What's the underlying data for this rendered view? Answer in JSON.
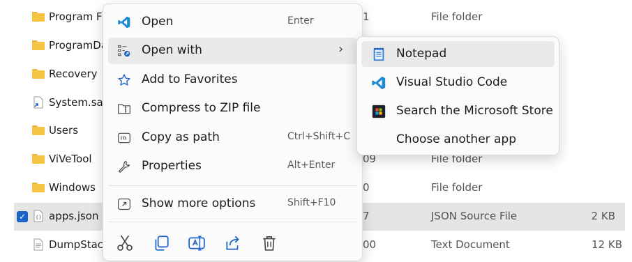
{
  "files": [
    {
      "name": "Program Fi",
      "date": "1",
      "type": "File folder",
      "size": "",
      "icon": "folder-icon"
    },
    {
      "name": "ProgramDa",
      "date": "",
      "type": "",
      "size": "",
      "icon": "folder-icon"
    },
    {
      "name": "Recovery",
      "date": "",
      "type": "",
      "size": "",
      "icon": "folder-icon"
    },
    {
      "name": "System.sav",
      "date": "",
      "type": "",
      "size": "",
      "icon": "shortcut-icon"
    },
    {
      "name": "Users",
      "date": "",
      "type": "",
      "size": "",
      "icon": "folder-icon"
    },
    {
      "name": "ViVeTool",
      "date": "09",
      "type": "File folder",
      "size": "",
      "icon": "folder-icon"
    },
    {
      "name": "Windows",
      "date": "0",
      "type": "File folder",
      "size": "",
      "icon": "folder-icon"
    },
    {
      "name": "apps.json",
      "date": "7",
      "type": "JSON Source File",
      "size": "2 KB",
      "icon": "json-file-icon",
      "selected": true
    },
    {
      "name": "DumpStack",
      "date": "00",
      "type": "Text Document",
      "size": "12 KB",
      "icon": "text-file-icon"
    }
  ],
  "context_menu": {
    "items": [
      {
        "label": "Open",
        "shortcut": "Enter",
        "icon": "vscode-icon"
      },
      {
        "label": "Open with",
        "shortcut": "",
        "icon": "open-with-icon",
        "has_submenu": true
      },
      {
        "label": "Add to Favorites",
        "shortcut": "",
        "icon": "star-icon"
      },
      {
        "label": "Compress to ZIP file",
        "shortcut": "",
        "icon": "zip-icon"
      },
      {
        "label": "Copy as path",
        "shortcut": "Ctrl+Shift+C",
        "icon": "copy-path-icon"
      },
      {
        "label": "Properties",
        "shortcut": "Alt+Enter",
        "icon": "wrench-icon"
      },
      {
        "label": "Show more options",
        "shortcut": "Shift+F10",
        "icon": "more-options-icon"
      }
    ],
    "toolbar": [
      "cut-icon",
      "copy-icon",
      "rename-icon",
      "share-icon",
      "delete-icon"
    ]
  },
  "submenu": {
    "items": [
      {
        "label": "Notepad",
        "icon": "notepad-icon"
      },
      {
        "label": "Visual Studio Code",
        "icon": "vscode-icon"
      },
      {
        "label": "Search the Microsoft Store",
        "icon": "store-icon"
      },
      {
        "label": "Choose another app",
        "icon": ""
      }
    ]
  },
  "colors": {
    "accent": "#1a62c8",
    "vscode": "#1f8ad2",
    "folder": "#f6c443",
    "selection": "#e5e5e5"
  }
}
